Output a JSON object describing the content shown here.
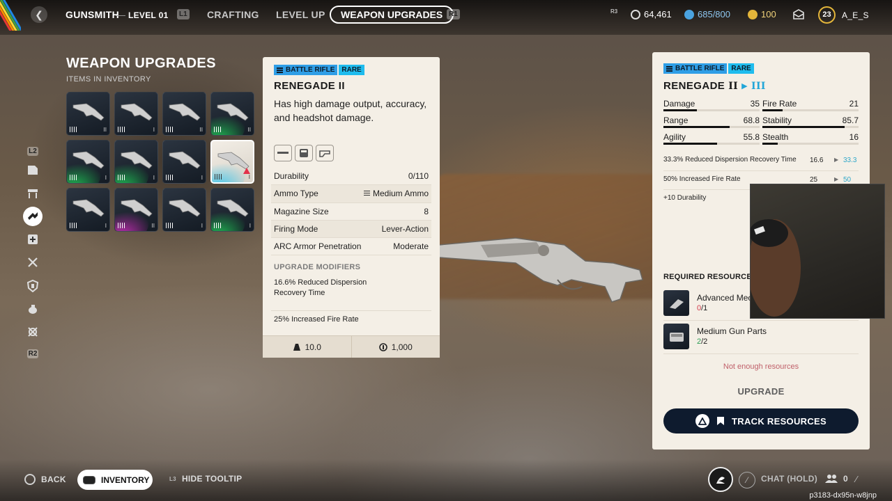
{
  "topbar": {
    "section": "GUNSMITH",
    "level": "LEVEL 01",
    "l1_tag": "L1",
    "r1_tag": "R1",
    "r3_tag": "R3",
    "tabs": [
      "CRAFTING",
      "LEVEL UP",
      "WEAPON UPGRADES"
    ],
    "active_tab": "WEAPON UPGRADES",
    "coins": "64,461",
    "cred": "685/800",
    "tokens": "100",
    "player_level": "23",
    "username": "A_E_S",
    "colors": {
      "cred": "#4aa3e0",
      "tokens": "#e3b53a",
      "coins": "#dddddd"
    }
  },
  "left": {
    "title": "WEAPON UPGRADES",
    "subtitle": "ITEMS IN INVENTORY",
    "side_tags": {
      "top": "L2",
      "bottom": "R2"
    },
    "side_icons": [
      "blueprint-icon",
      "bench-icon",
      "weapon-upgrade-icon",
      "medical-icon",
      "tools-icon",
      "shield-icon",
      "grenade-icon",
      "scrap-icon"
    ],
    "grid": [
      {
        "rarity": "none",
        "tier": "II"
      },
      {
        "rarity": "none",
        "tier": "I"
      },
      {
        "rarity": "none",
        "tier": "II"
      },
      {
        "rarity": "green",
        "tier": "II"
      },
      {
        "rarity": "green",
        "tier": "I"
      },
      {
        "rarity": "green",
        "tier": "I"
      },
      {
        "rarity": "none",
        "tier": "I"
      },
      {
        "rarity": "blue",
        "tier": "I",
        "selected": true
      },
      {
        "rarity": "none",
        "tier": "I"
      },
      {
        "rarity": "purple",
        "tier": "II"
      },
      {
        "rarity": "none",
        "tier": "I"
      },
      {
        "rarity": "green",
        "tier": "I"
      }
    ]
  },
  "tooltip": {
    "class": "BATTLE RIFLE",
    "rarity": "RARE",
    "name": "RENEGADE II",
    "description": "Has high damage output, accuracy, and headshot damage.",
    "rows": [
      {
        "label": "Durability",
        "value": "0/110"
      },
      {
        "label": "Ammo Type",
        "value": "Medium Ammo"
      },
      {
        "label": "Magazine Size",
        "value": "8"
      },
      {
        "label": "Firing Mode",
        "value": "Lever-Action"
      },
      {
        "label": "ARC Armor Penetration",
        "value": "Moderate"
      }
    ],
    "modifiers_heading": "UPGRADE MODIFIERS",
    "modifiers": [
      "16.6% Reduced Dispersion Recovery Time",
      "25% Increased Fire Rate"
    ],
    "weight": "10.0",
    "price": "1,000"
  },
  "panel": {
    "class": "BATTLE RIFLE",
    "rarity": "RARE",
    "name": "RENEGADE",
    "current_tier": "II",
    "next_tier": "III",
    "stats": [
      {
        "label": "Damage",
        "value": "35",
        "fill": 0.35
      },
      {
        "label": "Fire Rate",
        "value": "21",
        "fill": 0.21
      },
      {
        "label": "Range",
        "value": "68.8",
        "fill": 0.688
      },
      {
        "label": "Stability",
        "value": "85.7",
        "fill": 0.857
      },
      {
        "label": "Agility",
        "value": "55.8",
        "fill": 0.558
      },
      {
        "label": "Stealth",
        "value": "16",
        "fill": 0.16
      }
    ],
    "upgrades": [
      {
        "text": "33.3% Reduced Dispersion Recovery Time",
        "from": "16.6",
        "to": "33.3"
      },
      {
        "text": "50% Increased Fire Rate",
        "from": "25",
        "to": "50"
      },
      {
        "text": "+10 Durability",
        "from": "",
        "to": ""
      }
    ],
    "required_heading": "REQUIRED RESOURCES",
    "resources": [
      {
        "name": "Advanced Mec",
        "have": "0",
        "need": "/1",
        "enough": false
      },
      {
        "name": "Medium Gun Parts",
        "have": "2",
        "need": "/2",
        "enough": true
      }
    ],
    "not_enough": "Not enough resources",
    "upgrade_label": "UPGRADE",
    "track_label": "TRACK RESOURCES"
  },
  "bottom": {
    "back": "BACK",
    "inventory": "INVENTORY",
    "hide_tooltip": "HIDE TOOLTIP",
    "l3_tag": "L3",
    "chat": "CHAT (HOLD)",
    "party_count": "0",
    "watermark": "p3183-dx95n-w8jnp"
  }
}
